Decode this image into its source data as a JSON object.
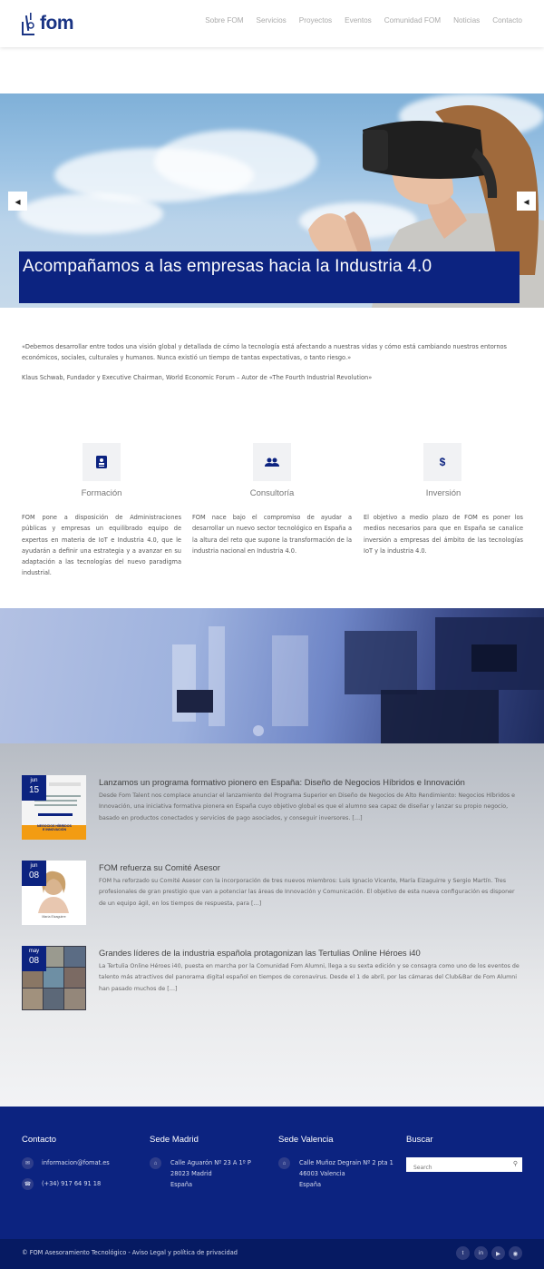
{
  "header": {
    "logo_text": "fom",
    "nav": [
      "Sobre FOM",
      "Servicios",
      "Proyectos",
      "Eventos",
      "Comunidad FOM",
      "Noticias",
      "Contacto"
    ]
  },
  "hero": {
    "caption": "Acompañamos a las empresas hacia la Industria 4.0",
    "prev_icon": "chevron-left-icon",
    "next_icon": "chevron-left-icon"
  },
  "quote": {
    "text": "«Debemos desarrollar entre todos una visión global y detallada de cómo la tecnología está afectando a nuestras vidas y cómo está cambiando nuestros entornos económicos, sociales, culturales y humanos. Nunca existió un tiempo de tantas expectativas, o tanto riesgo.»",
    "author": "Klaus Schwab, Fundador y Executive Chairman, World Economic Forum – Autor de «The Fourth Industrial Revolution»"
  },
  "features": [
    {
      "icon": "id-card-icon",
      "title": "Formación",
      "text": "FOM pone a disposición de Administraciones públicas y empresas un equilibrado equipo de expertos en materia de IoT e Industria 4.0, que le ayudarán a definir una estrategia y a avanzar en su adaptación a las tecnologías del nuevo paradigma industrial."
    },
    {
      "icon": "users-icon",
      "title": "Consultoría",
      "text": "FOM nace bajo el compromiso de ayudar a desarrollar un nuevo sector tecnológico en España a la altura del reto que supone la transformación de la industria nacional en Industria 4.0."
    },
    {
      "icon": "dollar-icon",
      "title": "Inversión",
      "text": "El objetivo a medio plazo de FOM es poner los medios necesarios para que en España se canalice inversión a empresas del ámbito de las tecnologías IoT y la industria 4.0."
    }
  ],
  "news": [
    {
      "month": "jun",
      "day": "15",
      "title": "Lanzamos un programa formativo pionero en España: Diseño de Negocios Híbridos e Innovación",
      "text": "Desde Fom Talent nos complace anunciar el lanzamiento del Programa Superior en Diseño de Negocios de Alto Rendimiento: Negocios Híbridos e Innovación, una iniciativa formativa pionera en España cuyo objetivo global es que el alumno sea capaz de diseñar y lanzar su propio negocio, basado en productos conectados y servicios de pago asociados, y conseguir inversores. […]",
      "thumb_label": "NEGOCIOS HÍBRIDOS E INNOVACIÓN"
    },
    {
      "month": "jun",
      "day": "08",
      "title": "FOM refuerza su Comité Asesor",
      "text": "FOM ha reforzado su Comité Asesor con la incorporación de tres nuevos miembros: Luis Ignacio Vicente, María Eizaguirre y Sergio Martín. Tres profesionales de gran prestigio que van a potenciar las áreas de Innovación y Comunicación. El objetivo de esta nueva configuración es disponer de un equipo ágil, en los tiempos de respuesta, para […]",
      "thumb_label": "María Eizaguirre"
    },
    {
      "month": "may",
      "day": "08",
      "title": "Grandes líderes de la industria española protagonizan las Tertulias Online Héroes i40",
      "text": "La Tertulia Online Héroes i40, puesta en marcha por la Comunidad Fom Alumni, llega a su sexta edición y se consagra como uno de los eventos de talento más atractivos del panorama digital español en tiempos de coronavirus. Desde el 1 de abril, por las cámaras del Club&Bar de Fom Alumni han pasado muchos de […]",
      "thumb_label": ""
    }
  ],
  "footer": {
    "contacto": {
      "heading": "Contacto",
      "email": "informacion@fomat.es",
      "phone": "(+34) 917 64 91 18"
    },
    "madrid": {
      "heading": "Sede Madrid",
      "line1": "Calle Aguarón Nº 23 A 1º P",
      "line2": "28023 Madrid",
      "line3": "España"
    },
    "valencia": {
      "heading": "Sede Valencia",
      "line1": "Calle Muñoz Degrain Nº 2 pta 1",
      "line2": "46003 Valencia",
      "line3": "España"
    },
    "buscar": {
      "heading": "Buscar",
      "placeholder": "Search"
    },
    "copyright": "© FOM Asesoramiento Tecnológico - Aviso Legal y política de privacidad",
    "social": [
      "twitter-icon",
      "linkedin-icon",
      "youtube-icon",
      "instagram-icon"
    ]
  },
  "colors": {
    "brand": "#0c2380",
    "bottom_bar": "#061a62"
  }
}
